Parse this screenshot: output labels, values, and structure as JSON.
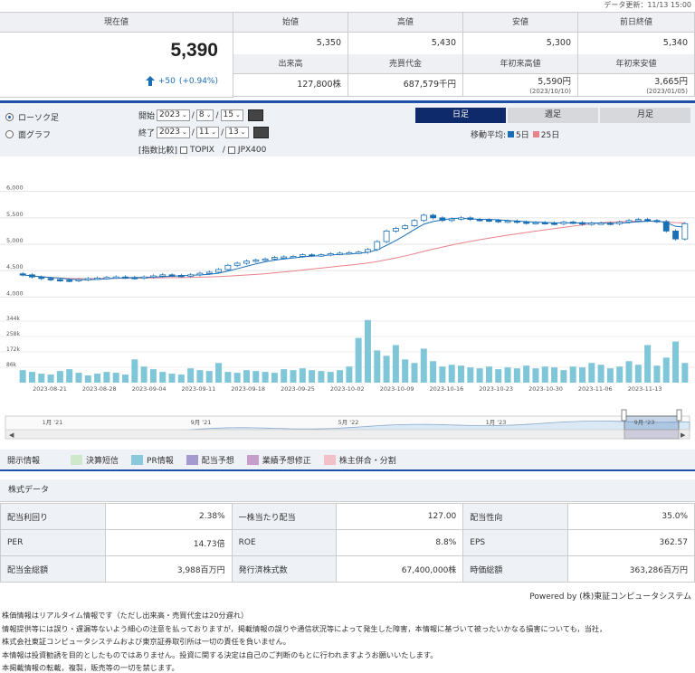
{
  "update": "データ更新：11/13 15:00",
  "quote": {
    "current_label": "現在値",
    "current_price": "5,390",
    "change": "+50",
    "change_pct": "(+0.94%)",
    "cells": [
      {
        "label": "始値",
        "value": "5,350"
      },
      {
        "label": "高値",
        "value": "5,430"
      },
      {
        "label": "安値",
        "value": "5,300"
      },
      {
        "label": "前日終値",
        "value": "5,340"
      },
      {
        "label": "出来高",
        "value": "127,800株"
      },
      {
        "label": "売買代金",
        "value": "687,579千円"
      },
      {
        "label": "年初来高値",
        "value": "5,590円",
        "sub": "(2023/10/10)"
      },
      {
        "label": "年初来安値",
        "value": "3,665円",
        "sub": "(2023/01/05)"
      }
    ]
  },
  "controls": {
    "radio_candle": "ローソク足",
    "radio_line": "面グラフ",
    "start_label": "開始",
    "end_label": "終了",
    "start": {
      "year": "2023",
      "month": "8",
      "day": "15"
    },
    "end": {
      "year": "2023",
      "month": "11",
      "day": "13"
    },
    "compare_label": "[指数比較]",
    "topix": "TOPIX",
    "sep": "/",
    "jpx": "JPX400",
    "tabs": [
      "日足",
      "週足",
      "月足"
    ],
    "ma_label": "移動平均:",
    "ma5": "5日",
    "ma25": "25日",
    "colors": {
      "ma5": "#1a6fb5",
      "ma25": "#e9828c",
      "accent": "#1f4fa6"
    }
  },
  "chart_data": {
    "type": "candlestick",
    "y_ticks": [
      "6,000",
      "5,500",
      "5,000",
      "4,500",
      "4,000"
    ],
    "ylim": [
      3800,
      6200
    ],
    "vol_ticks": [
      "344k",
      "258k",
      "172k",
      "86k"
    ],
    "vol_max": 344,
    "x_ticks": [
      "2023-08-21",
      "2023-08-28",
      "2023-09-04",
      "2023-09-11",
      "2023-09-18",
      "2023-09-25",
      "2023-10-02",
      "2023-10-09",
      "2023-10-16",
      "2023-10-23",
      "2023-10-30",
      "2023-11-06",
      "2023-11-13"
    ],
    "closes": [
      4420,
      4380,
      4350,
      4330,
      4320,
      4310,
      4330,
      4350,
      4360,
      4370,
      4380,
      4370,
      4360,
      4380,
      4400,
      4420,
      4410,
      4400,
      4420,
      4450,
      4470,
      4520,
      4600,
      4640,
      4680,
      4700,
      4720,
      4750,
      4760,
      4770,
      4800,
      4790,
      4800,
      4820,
      4830,
      4840,
      4850,
      4900,
      5050,
      5250,
      5300,
      5350,
      5450,
      5550,
      5500,
      5450,
      5480,
      5500,
      5470,
      5460,
      5450,
      5430,
      5440,
      5420,
      5400,
      5410,
      5400,
      5390,
      5420,
      5410,
      5380,
      5400,
      5400,
      5390,
      5420,
      5450,
      5470,
      5450,
      5430,
      5250,
      5100,
      5390
    ],
    "volumes": [
      70,
      60,
      50,
      45,
      65,
      75,
      55,
      40,
      50,
      60,
      55,
      45,
      130,
      90,
      75,
      60,
      50,
      45,
      80,
      70,
      65,
      110,
      60,
      55,
      70,
      65,
      60,
      55,
      75,
      70,
      80,
      70,
      65,
      60,
      70,
      90,
      250,
      350,
      180,
      150,
      210,
      130,
      110,
      190,
      120,
      90,
      100,
      95,
      85,
      80,
      90,
      75,
      85,
      80,
      95,
      80,
      90,
      85,
      70,
      90,
      85,
      110,
      100,
      80,
      90,
      120,
      100,
      210,
      95,
      140,
      230,
      110
    ],
    "ma5_label": "5日",
    "ma25_label": "25日",
    "ranger_labels": [
      "1月 '21",
      "9月 '21",
      "5月 '22",
      "1月 '23",
      "9月 '23"
    ]
  },
  "legend": {
    "title": "開示情報",
    "items": [
      {
        "label": "決算短信",
        "color": "#cfe8cc"
      },
      {
        "label": "PR情報",
        "color": "#8cc8dc"
      },
      {
        "label": "配当予想",
        "color": "#a59ad0"
      },
      {
        "label": "業績予想修正",
        "color": "#c79dcc"
      },
      {
        "label": "株主併合・分割",
        "color": "#f2c0c8"
      }
    ]
  },
  "stock": {
    "title": "株式データ",
    "rows": [
      [
        {
          "k": "配当利回り",
          "v": "2.38%"
        },
        {
          "k": "一株当たり配当",
          "v": "127.00"
        },
        {
          "k": "配当性向",
          "v": "35.0%"
        }
      ],
      [
        {
          "k": "PER",
          "v": "14.73倍"
        },
        {
          "k": "ROE",
          "v": "8.8%"
        },
        {
          "k": "EPS",
          "v": "362.57"
        }
      ],
      [
        {
          "k": "配当金総額",
          "v": "3,988百万円"
        },
        {
          "k": "発行済株式数",
          "v": "67,400,000株"
        },
        {
          "k": "時価総額",
          "v": "363,286百万円"
        }
      ]
    ]
  },
  "powered": "Powered by (株)東証コンピュータシステム",
  "notes": [
    "株価情報はリアルタイム情報です（ただし出来高・売買代金は20分遅れ）",
    "情報提供等には誤り・遅漏等ないよう細心の注意を払っておりますが，掲載情報の誤りや通信状況等によって発生した障害，本情報に基づいて被ったいかなる損害についても，当社，",
    "株式会社東証コンピュータシステムおよび東京証券取引所は一切の責任を負いません。",
    "本情報は投資勧誘を目的としたものではありません。投資に関する決定は自己のご判断のもとに行われますようお願いいたします。",
    "本掲載情報の転載，複製，販売等の一切を禁じます。"
  ]
}
